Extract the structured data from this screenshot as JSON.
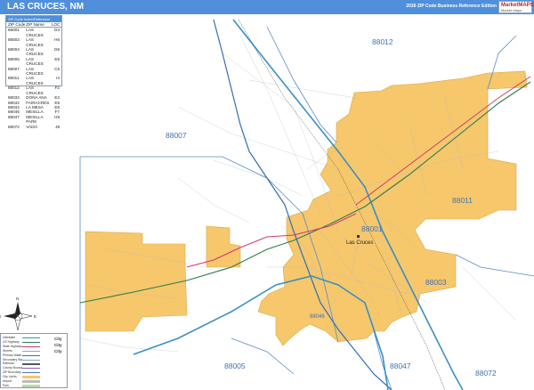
{
  "header": {
    "title": "LAS CRUCES, NM",
    "edition": "2026 ZIP Code Business Reference Edition",
    "brand": {
      "name": "MarketMAPS",
      "sub": "Market Maps"
    }
  },
  "zip_table": {
    "title": "ZIP Code Index/Reference Locator",
    "columns": [
      "ZIP Code",
      "ZIP Name",
      "LOC"
    ],
    "rows": [
      [
        "88001",
        "LAS CRUCES",
        "D4"
      ],
      [
        "88003",
        "LAS CRUCES",
        "H6"
      ],
      [
        "88004",
        "LAS CRUCES",
        "D6"
      ],
      [
        "88005",
        "LAS CRUCES",
        "E6"
      ],
      [
        "88007",
        "LAS CRUCES",
        "C5"
      ],
      [
        "88011",
        "LAS CRUCES",
        "I4"
      ],
      [
        "88012",
        "LAS CRUCES",
        "F2"
      ],
      [
        "88033",
        "DONA ANA",
        "E2"
      ],
      [
        "88042",
        "FAIRACRES",
        "E5"
      ],
      [
        "88044",
        "LA MESA",
        "E5"
      ],
      [
        "88046",
        "MESILLA",
        "F7"
      ],
      [
        "88047",
        "MESILLA PARK",
        "H8"
      ],
      [
        "88072",
        "VADO",
        "J8"
      ]
    ]
  },
  "legend": {
    "items": [
      {
        "label": "Interstate",
        "color": "#3a8fc6"
      },
      {
        "label": "US Highway",
        "color": "#2e7d4f"
      },
      {
        "label": "State Highway",
        "color": "#cc3366"
      },
      {
        "label": "Streets",
        "color": "#9aa4ad"
      },
      {
        "label": "Primary Water",
        "color": "#3a6fb0"
      },
      {
        "label": "Secondary Water",
        "color": "#7aa7d6"
      },
      {
        "label": "Railroad",
        "color": "#555555"
      },
      {
        "label": "County Boundary",
        "color": "#8a5bb0"
      },
      {
        "label": "ZIP Boundary",
        "color": "#4a7fc1"
      },
      {
        "label": "City Limits",
        "color": "#f5c96a"
      },
      {
        "label": "Airport",
        "color": "#bbbbbb"
      },
      {
        "label": "Park",
        "color": "#b7d9a8"
      }
    ],
    "city_text": "City"
  },
  "map": {
    "zip_labels": [
      {
        "zip": "88012",
        "color": "#3f73b6"
      },
      {
        "zip": "88007",
        "color": "#3f73b6"
      },
      {
        "zip": "88011",
        "color": "#3f73b6"
      },
      {
        "zip": "88001",
        "color": "#3f73b6"
      },
      {
        "zip": "88003",
        "color": "#3f73b6"
      },
      {
        "zip": "88046",
        "color": "#3f73b6"
      },
      {
        "zip": "88005",
        "color": "#3f73b6"
      },
      {
        "zip": "88047",
        "color": "#3f73b6"
      },
      {
        "zip": "88072",
        "color": "#3f73b6"
      }
    ],
    "city_label": "Las Cruces",
    "city_fill_color": "#f6c76b",
    "compass": {
      "n": "N",
      "s": "S",
      "e": "E",
      "w": "W"
    }
  }
}
